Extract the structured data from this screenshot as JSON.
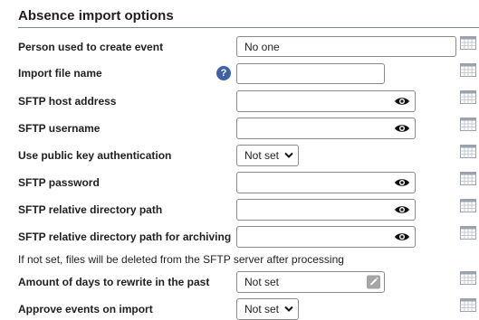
{
  "section": {
    "title": "Absence import options"
  },
  "rows": {
    "person": {
      "label": "Person used to create event",
      "value": "No one"
    },
    "import_file": {
      "label": "Import file name",
      "value": "",
      "help": "?"
    },
    "sftp_host": {
      "label": "SFTP host address",
      "value": ""
    },
    "sftp_user": {
      "label": "SFTP username",
      "value": ""
    },
    "public_key": {
      "label": "Use public key authentication",
      "value": "Not set"
    },
    "sftp_password": {
      "label": "SFTP password",
      "value": ""
    },
    "sftp_dir": {
      "label": "SFTP relative directory path",
      "value": ""
    },
    "sftp_archive": {
      "label": "SFTP relative directory path for archiving",
      "value": "",
      "note": "If not set, files will be deleted from the SFTP server after processing"
    },
    "rewrite_days": {
      "label": "Amount of days to rewrite in the past",
      "value": "Not set"
    },
    "approve": {
      "label": "Approve events on import",
      "value": "Not set"
    }
  },
  "icons": {
    "eye": "eye-icon",
    "calendar": "calendar-icon",
    "pencil": "pencil-icon",
    "chevron": "chevron-down-icon",
    "help": "help-icon"
  },
  "colors": {
    "help_badge": "#3e62a8",
    "field_border": "#8a8a8a",
    "calendar": "#9aa3ad"
  }
}
